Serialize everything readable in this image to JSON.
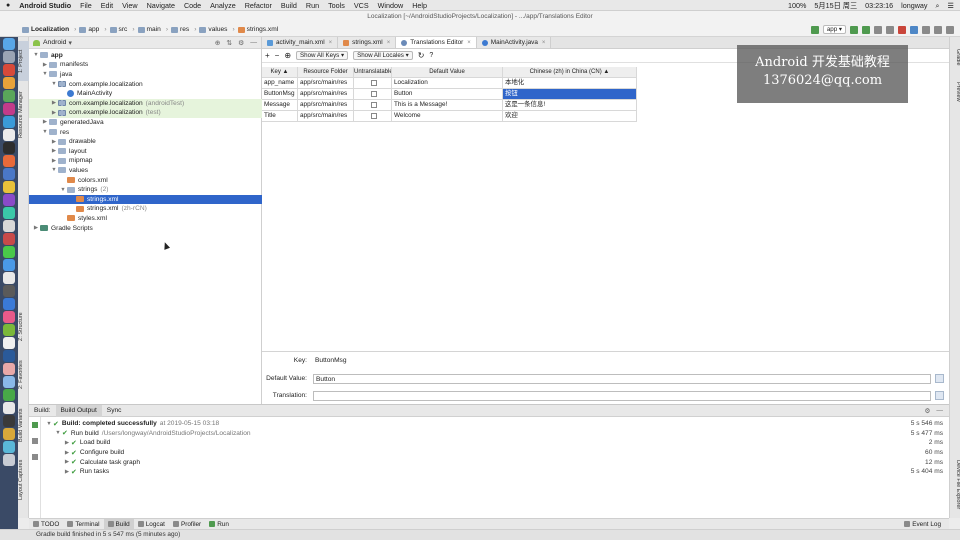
{
  "menubar": {
    "apple": "",
    "app_name": "Android Studio",
    "items": [
      "File",
      "Edit",
      "View",
      "Navigate",
      "Code",
      "Analyze",
      "Refactor",
      "Build",
      "Run",
      "Tools",
      "VCS",
      "Window",
      "Help"
    ],
    "status": {
      "battery": "100%",
      "date": "5月15日 周三",
      "time": "03:23:16",
      "user": "longway"
    }
  },
  "window_title": "Localization [~/AndroidStudioProjects/Localization] - .../app/Translations Editor",
  "breadcrumbs": [
    "Localization",
    "app",
    "src",
    "main",
    "res",
    "values",
    "strings.xml"
  ],
  "run_config": "app",
  "project_panel": {
    "view_mode": "Android",
    "tree": [
      {
        "label": "app",
        "level": 0,
        "type": "folder",
        "open": true
      },
      {
        "label": "manifests",
        "level": 1,
        "type": "folder",
        "open": false
      },
      {
        "label": "java",
        "level": 1,
        "type": "folder",
        "open": true
      },
      {
        "label": "com.example.localization",
        "level": 2,
        "type": "pkg",
        "open": true
      },
      {
        "label": "MainActivity",
        "level": 3,
        "type": "class"
      },
      {
        "label": "com.example.localization",
        "level": 2,
        "type": "pkg",
        "open": false,
        "suffix": "(androidTest)",
        "hl": true
      },
      {
        "label": "com.example.localization",
        "level": 2,
        "type": "pkg",
        "open": false,
        "suffix": "(test)",
        "hl": true
      },
      {
        "label": "generatedJava",
        "level": 1,
        "type": "folder",
        "open": false
      },
      {
        "label": "res",
        "level": 1,
        "type": "folder",
        "open": true
      },
      {
        "label": "drawable",
        "level": 2,
        "type": "folder",
        "open": false
      },
      {
        "label": "layout",
        "level": 2,
        "type": "folder",
        "open": false
      },
      {
        "label": "mipmap",
        "level": 2,
        "type": "folder",
        "open": false
      },
      {
        "label": "values",
        "level": 2,
        "type": "folder",
        "open": true
      },
      {
        "label": "colors.xml",
        "level": 3,
        "type": "xml"
      },
      {
        "label": "strings",
        "level": 3,
        "type": "folder",
        "open": true,
        "suffix": "(2)"
      },
      {
        "label": "strings.xml",
        "level": 4,
        "type": "xml",
        "sel": true
      },
      {
        "label": "strings.xml",
        "level": 4,
        "type": "xml",
        "suffix": "(zh-rCN)"
      },
      {
        "label": "styles.xml",
        "level": 3,
        "type": "xml"
      },
      {
        "label": "Gradle Scripts",
        "level": 0,
        "type": "gradle",
        "open": false
      }
    ]
  },
  "editor_tabs": [
    {
      "label": "activity_main.xml",
      "active": false
    },
    {
      "label": "strings.xml",
      "active": false
    },
    {
      "label": "Translations Editor",
      "active": true
    },
    {
      "label": "MainActivity.java",
      "active": false
    }
  ],
  "translations": {
    "toolbar": {
      "add": "+",
      "remove": "−",
      "globe": "⊕",
      "show_keys": "Show All Keys ▾",
      "show_locales": "Show All Locales ▾",
      "refresh": "↻",
      "help": "?"
    },
    "columns": [
      "Key ▲",
      "Resource Folder",
      "Untranslatable",
      "Default Value",
      "Chinese (zh) in China (CN) ▲"
    ],
    "rows": [
      {
        "key": "app_name",
        "folder": "app/src/main/res",
        "default": "Localization",
        "zh": "本地化"
      },
      {
        "key": "ButtonMsg",
        "folder": "app/src/main/res",
        "default": "Button",
        "zh": "按钮",
        "selected": true
      },
      {
        "key": "Message",
        "folder": "app/src/main/res",
        "default": "This is a Message!",
        "zh": "这是一条信息!"
      },
      {
        "key": "Title",
        "folder": "app/src/main/res",
        "default": "Welcome",
        "zh": "欢迎"
      }
    ],
    "key_label": "Key:",
    "key_value": "ButtonMsg",
    "default_label": "Default Value:",
    "default_value": "Button",
    "translation_label": "Translation:",
    "translation_value": ""
  },
  "build_panel": {
    "tabs": [
      "Build:",
      "Build Output",
      "Sync"
    ],
    "lines": [
      {
        "text": "Build: completed successfully",
        "sub": "at 2019-05-15 03:18",
        "time": "5 s 546 ms",
        "level": 0
      },
      {
        "text": "Run build",
        "sub": "/Users/longway/AndroidStudioProjects/Localization",
        "time": "5 s 477 ms",
        "level": 1
      },
      {
        "text": "Load build",
        "sub": "",
        "time": "2 ms",
        "level": 2
      },
      {
        "text": "Configure build",
        "sub": "",
        "time": "60 ms",
        "level": 2
      },
      {
        "text": "Calculate task graph",
        "sub": "",
        "time": "12 ms",
        "level": 2
      },
      {
        "text": "Run tasks",
        "sub": "",
        "time": "5 s 404 ms",
        "level": 2
      }
    ]
  },
  "tool_windows": [
    "TODO",
    "Terminal",
    "Build",
    "Logcat",
    "Profiler",
    "Run"
  ],
  "event_log": "Event Log",
  "status_text": "Gradle build finished in 5 s 547 ms (5 minutes ago)",
  "left_tabs": [
    "1: Project",
    "Resource Manager",
    "Z: Structure",
    "2: Favorites",
    "Build Variants",
    "Layout Captures"
  ],
  "right_tabs": [
    "Gradle",
    "Preview",
    "Device File Explorer"
  ],
  "overlay": {
    "line1": "Android 开发基础教程",
    "line2": "1376024@qq.com"
  },
  "colors": {
    "selection": "#2f65ca",
    "highlight": "#e6f4dc",
    "dock": "#3a4a66"
  }
}
